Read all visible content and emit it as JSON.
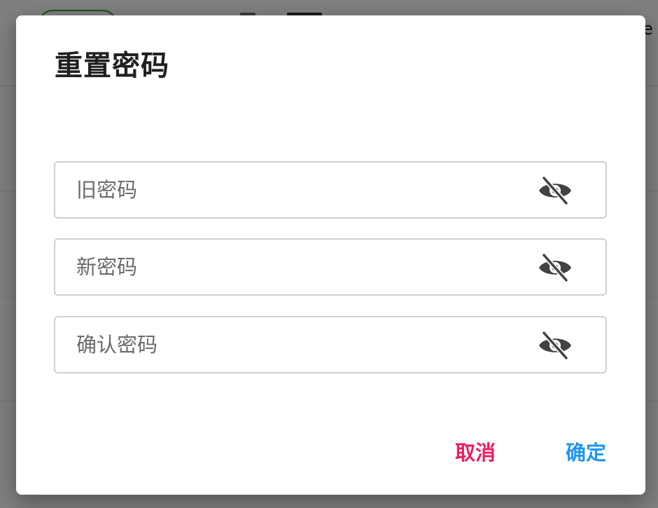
{
  "background": {
    "edge_text": "e"
  },
  "dialog": {
    "title": "重置密码",
    "fields": [
      {
        "name": "old-password",
        "placeholder": "旧密码",
        "value": "",
        "icon": "eye-off-icon"
      },
      {
        "name": "new-password",
        "placeholder": "新密码",
        "value": "",
        "icon": "eye-off-icon"
      },
      {
        "name": "confirm-password",
        "placeholder": "确认密码",
        "value": "",
        "icon": "eye-off-icon"
      }
    ],
    "actions": {
      "cancel_label": "取消",
      "ok_label": "确定"
    },
    "colors": {
      "cancel": "#e91e63",
      "ok": "#2196f3"
    }
  }
}
